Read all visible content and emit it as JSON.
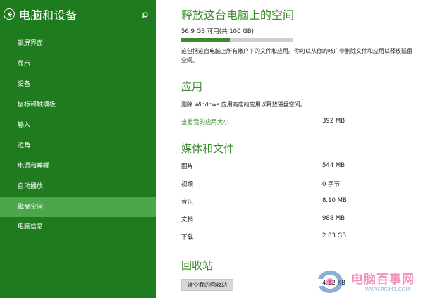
{
  "sidebar": {
    "title": "电脑和设备",
    "items": [
      {
        "label": "锁屏界面"
      },
      {
        "label": "显示"
      },
      {
        "label": "设备"
      },
      {
        "label": "鼠标和触摸板"
      },
      {
        "label": "输入"
      },
      {
        "label": "边角"
      },
      {
        "label": "电源和睡眠"
      },
      {
        "label": "自动播放"
      },
      {
        "label": "磁盘空间",
        "selected": true
      },
      {
        "label": "电脑信息"
      }
    ],
    "bg_color": "#1e7b1e",
    "selected_color": "#4ca64a"
  },
  "main": {
    "title": "释放这台电脑上的空间",
    "storage_text": "56.9 GB 可用(共 100 GB)",
    "storage_used_fraction": 0.431,
    "description": "这包括这台电脑上所有帐户下的文件和应用。你可以从你的帐户中删除文件和应用以释放磁盘空间。",
    "apps": {
      "heading": "应用",
      "description": "删除 Windows 应用商店的应用以释放磁盘空间。",
      "link_label": "查看我的应用大小",
      "link_value": "392 MB"
    },
    "media": {
      "heading": "媒体和文件",
      "rows": [
        {
          "label": "图片",
          "value": "544 MB"
        },
        {
          "label": "视频",
          "value": "0 字节"
        },
        {
          "label": "音乐",
          "value": "8.10 MB"
        },
        {
          "label": "文档",
          "value": "988 MB"
        },
        {
          "label": "下载",
          "value": "2.83 GB"
        }
      ]
    },
    "recycle": {
      "heading": "回收站",
      "button_label": "清空我的回收站",
      "value": "4.12 KB"
    },
    "accent_color": "#3a8b2c"
  },
  "watermark": {
    "text": "电脑百事网",
    "url": "WWW.PC841.COM"
  }
}
